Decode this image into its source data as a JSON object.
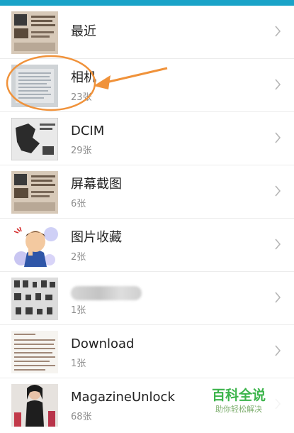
{
  "albums": [
    {
      "name": "最近",
      "count": ""
    },
    {
      "name": "相机",
      "count": "23张"
    },
    {
      "name": "DCIM",
      "count": "29张"
    },
    {
      "name": "屏幕截图",
      "count": "6张"
    },
    {
      "name": "图片收藏",
      "count": "2张"
    },
    {
      "name": "",
      "count": "1张"
    },
    {
      "name": "Download",
      "count": "1张"
    },
    {
      "name": "MagazineUnlock",
      "count": "68张"
    }
  ],
  "watermark": {
    "title": "百科全说",
    "subtitle": "助你轻松解决"
  },
  "colors": {
    "topbar": "#1aa3c8",
    "annotation": "#f0923a",
    "watermark": "#3cb44b"
  }
}
